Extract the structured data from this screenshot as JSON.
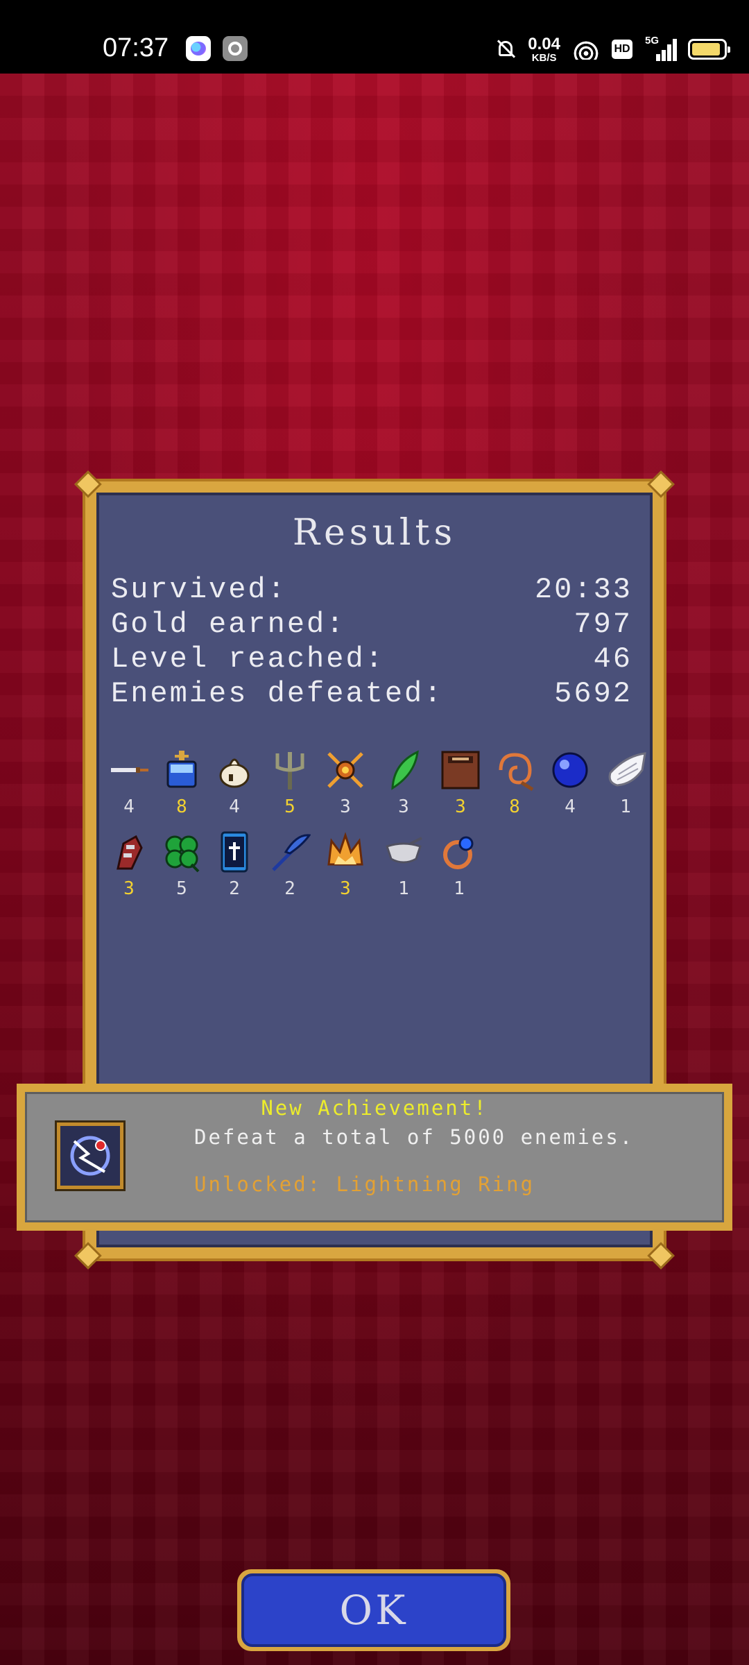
{
  "status_bar": {
    "time": "07:37",
    "net_speed_value": "0.04",
    "net_speed_unit": "KB/S",
    "hd_label": "HD",
    "signal_label": "5G"
  },
  "results": {
    "title": "Results",
    "stats": [
      {
        "label": "Survived:",
        "value": "20:33"
      },
      {
        "label": "Gold earned:",
        "value": "797"
      },
      {
        "label": "Level reached:",
        "value": "46"
      },
      {
        "label": "Enemies defeated:",
        "value": "5692"
      }
    ],
    "items": [
      {
        "icon": "knife-icon",
        "count": "4",
        "highlight": false
      },
      {
        "icon": "holy-water-icon",
        "count": "8",
        "highlight": true
      },
      {
        "icon": "garlic-icon",
        "count": "4",
        "highlight": false
      },
      {
        "icon": "trident-icon",
        "count": "5",
        "highlight": true
      },
      {
        "icon": "spinach-icon",
        "count": "3",
        "highlight": false
      },
      {
        "icon": "feather-icon",
        "count": "3",
        "highlight": false
      },
      {
        "icon": "tome-icon",
        "count": "3",
        "highlight": true
      },
      {
        "icon": "whip-icon",
        "count": "8",
        "highlight": true
      },
      {
        "icon": "orb-icon",
        "count": "4",
        "highlight": false
      },
      {
        "icon": "wings-icon",
        "count": "1",
        "highlight": false
      },
      {
        "icon": "armor-gauntlet-icon",
        "count": "3",
        "highlight": true
      },
      {
        "icon": "clover-icon",
        "count": "5",
        "highlight": false
      },
      {
        "icon": "bible-icon",
        "count": "2",
        "highlight": false
      },
      {
        "icon": "scythe-icon",
        "count": "2",
        "highlight": false
      },
      {
        "icon": "crown-icon",
        "count": "3",
        "highlight": true
      },
      {
        "icon": "silver-pot-icon",
        "count": "1",
        "highlight": false
      },
      {
        "icon": "ring-icon",
        "count": "1",
        "highlight": false
      }
    ]
  },
  "achievement": {
    "title": "New Achievement!",
    "description": "Defeat a total of 5000 enemies.",
    "unlock": "Unlocked: Lightning Ring",
    "icon": "lightning-ring-icon"
  },
  "ok_label": "OK",
  "colors": {
    "background": "#8c0620",
    "panel": "#4a5079",
    "gold_frame": "#d9a640",
    "highlight_count": "#f2d130",
    "ok_button": "#2c43c9"
  }
}
